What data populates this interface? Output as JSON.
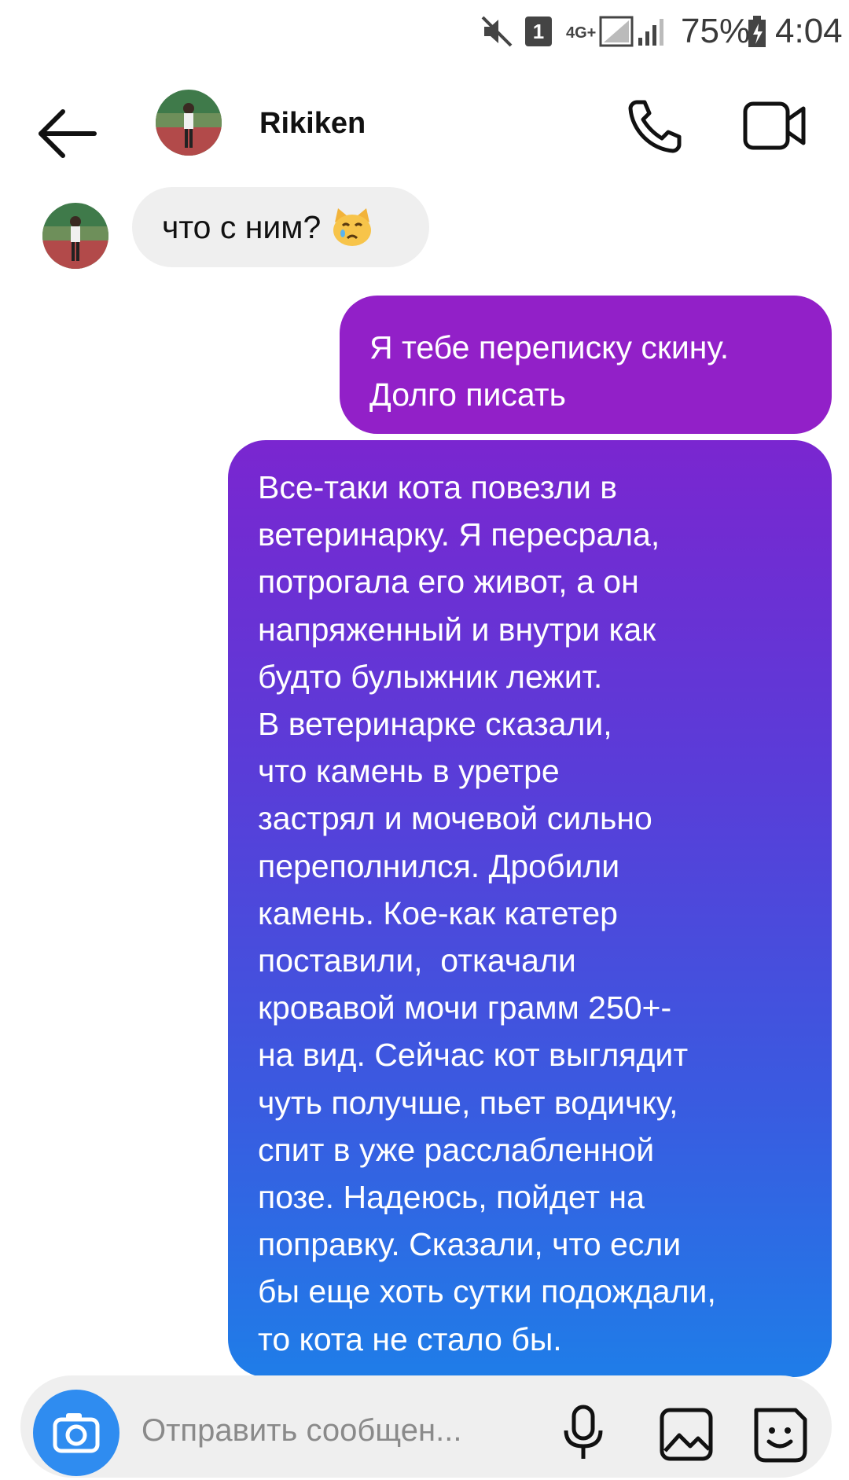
{
  "status_bar": {
    "sim_badge": "1",
    "network_label": "4G+",
    "battery_percent": "75%",
    "time": "4:04"
  },
  "header": {
    "contact_name": "Rikiken"
  },
  "messages": {
    "incoming": {
      "text": "что с ним?"
    },
    "outgoing_1": {
      "lines": [
        "Я тебе переписку скину.",
        "Долго писать"
      ]
    },
    "outgoing_2": {
      "lines": [
        "Все-таки кота повезли в",
        "ветеринарку. Я пересрала,",
        "потрогала его живот, а он",
        "напряженный и внутри как",
        "будто булыжник лежит.",
        "В ветеринарке сказали,",
        "что камень в уретре",
        "застрял и мочевой сильно",
        "переполнился. Дробили",
        "камень. Кое-как катетер",
        "поставили,  откачали",
        "кровавой мочи грамм 250+-",
        "на вид. Сейчас кот выглядит",
        "чуть получше, пьет водичку,",
        "спит в уже расслабленной",
        "позе. Надеюсь, пойдет на",
        "поправку. Сказали, что если",
        "бы еще хоть сутки подождали,",
        "то кота не стало бы."
      ]
    }
  },
  "composer": {
    "placeholder": "Отправить сообщен..."
  },
  "colors": {
    "bubble_in": "#efefef",
    "bubble_out_top": "#9220c8",
    "bubble_out_bottom": "#1f7de8",
    "camera_button": "#2f8cf0"
  }
}
